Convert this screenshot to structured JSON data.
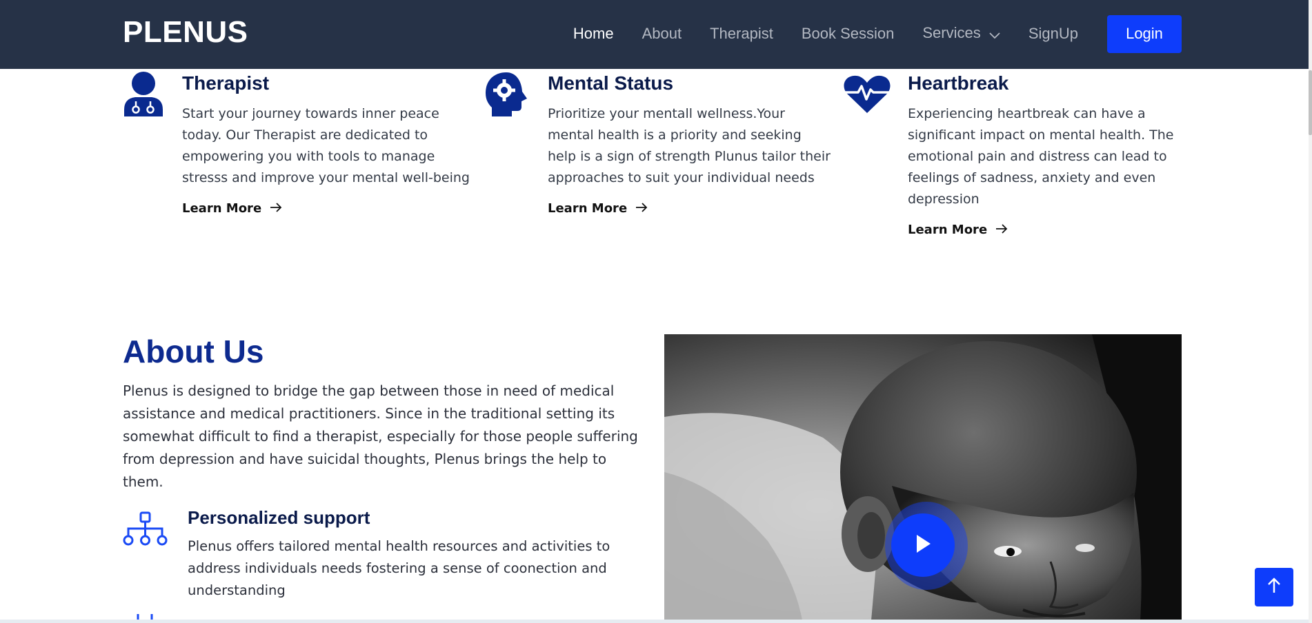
{
  "header": {
    "logo": "PLENUS",
    "nav": [
      {
        "label": "Home",
        "active": true
      },
      {
        "label": "About"
      },
      {
        "label": "Therapist"
      },
      {
        "label": "Book Session"
      },
      {
        "label": "Services",
        "has_dropdown": true
      },
      {
        "label": "SignUp"
      }
    ],
    "login_label": "Login"
  },
  "features": [
    {
      "icon": "doctor-icon",
      "title": "Therapist",
      "text": "Start your journey towards inner peace today. Our Therapist are dedicated to empowering you with tools to manage stresss and improve your mental well-being",
      "link": "Learn More"
    },
    {
      "icon": "head-gear-icon",
      "title": "Mental Status",
      "text": "Prioritize your mentall wellness.Your mental health is a priority and seeking help is a sign of strength Plunus tailor their approaches to suit your individual needs",
      "link": "Learn More"
    },
    {
      "icon": "heart-pulse-icon",
      "title": "Heartbreak",
      "text": "Experiencing heartbreak can have a significant impact on mental health. The emotional pain and distress can lead to feelings of sadness, anxiety and even depression",
      "link": "Learn More"
    }
  ],
  "about": {
    "title": "About Us",
    "text": "Plenus is designed to bridge the gap between those in need of medical assistance and medical practitioners. Since in the traditional setting its somewhat difficult to find a therapist, especially for those people suffering from depression and have suicidal thoughts, Plenus brings the help to them.",
    "items": [
      {
        "icon": "network-icon",
        "title": "Personalized support",
        "text": "Plenus offers tailored mental health resources and activities to address individuals needs fostering a sense of coonection and understanding"
      },
      {
        "icon": "partial-icon",
        "title": ""
      }
    ]
  },
  "colors": {
    "header_bg": "#263247",
    "accent": "#0e3dfb",
    "heading_blue": "#0d2a8f",
    "icon_blue": "#0a2a8f"
  }
}
